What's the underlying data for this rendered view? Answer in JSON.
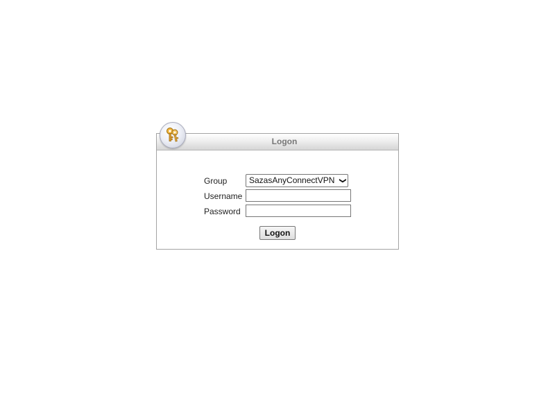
{
  "panel": {
    "title": "Logon",
    "icon": "keys-icon"
  },
  "form": {
    "group_label": "Group",
    "group_selected": "SazasAnyConnectVPN",
    "username_label": "Username",
    "username_value": "",
    "password_label": "Password",
    "password_value": "",
    "submit_label": "Logon"
  }
}
